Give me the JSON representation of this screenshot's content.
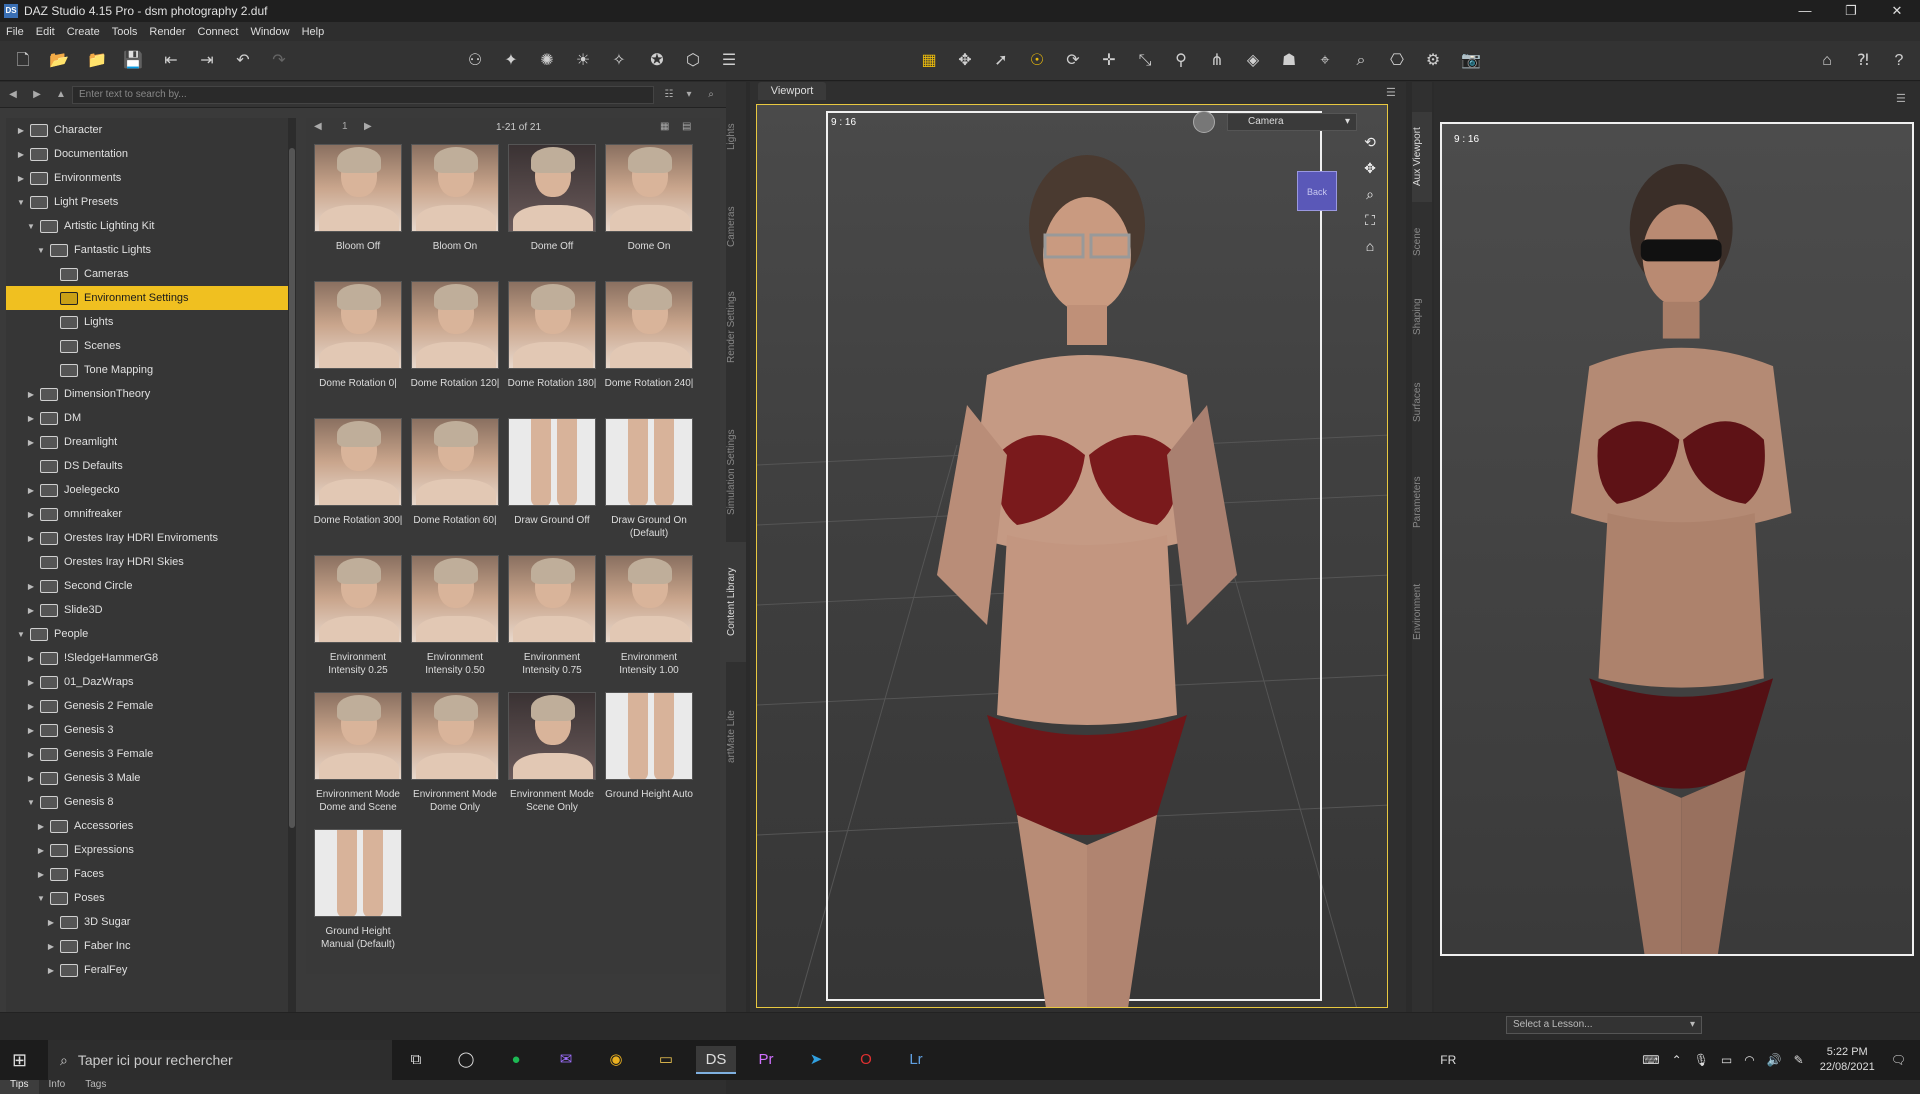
{
  "window": {
    "title": "DAZ Studio 4.15 Pro - dsm photography 2.duf",
    "app_icon": "DS",
    "min": "—",
    "max": "❐",
    "close": "✕"
  },
  "menu": [
    "File",
    "Edit",
    "Create",
    "Tools",
    "Render",
    "Connect",
    "Window",
    "Help"
  ],
  "search": {
    "placeholder": "Enter text to search by..."
  },
  "tree": [
    {
      "label": "Character",
      "indent": 1,
      "arrow": "▶"
    },
    {
      "label": "Documentation",
      "indent": 1,
      "arrow": "▶"
    },
    {
      "label": "Environments",
      "indent": 1,
      "arrow": "▶"
    },
    {
      "label": "Light Presets",
      "indent": 1,
      "arrow": "▼"
    },
    {
      "label": "Artistic Lighting Kit",
      "indent": 2,
      "arrow": "▼"
    },
    {
      "label": "Fantastic Lights",
      "indent": 3,
      "arrow": "▼"
    },
    {
      "label": "Cameras",
      "indent": 4,
      "arrow": ""
    },
    {
      "label": "Environment Settings",
      "indent": 4,
      "arrow": "",
      "selected": true
    },
    {
      "label": "Lights",
      "indent": 4,
      "arrow": ""
    },
    {
      "label": "Scenes",
      "indent": 4,
      "arrow": ""
    },
    {
      "label": "Tone Mapping",
      "indent": 4,
      "arrow": ""
    },
    {
      "label": "DimensionTheory",
      "indent": 2,
      "arrow": "▶"
    },
    {
      "label": "DM",
      "indent": 2,
      "arrow": "▶"
    },
    {
      "label": "Dreamlight",
      "indent": 2,
      "arrow": "▶"
    },
    {
      "label": "DS Defaults",
      "indent": 2,
      "arrow": ""
    },
    {
      "label": "Joelegecko",
      "indent": 2,
      "arrow": "▶"
    },
    {
      "label": "omnifreaker",
      "indent": 2,
      "arrow": "▶"
    },
    {
      "label": "Orestes Iray HDRI Enviroments",
      "indent": 2,
      "arrow": "▶"
    },
    {
      "label": "Orestes Iray HDRI Skies",
      "indent": 2,
      "arrow": ""
    },
    {
      "label": "Second Circle",
      "indent": 2,
      "arrow": "▶"
    },
    {
      "label": "Slide3D",
      "indent": 2,
      "arrow": "▶"
    },
    {
      "label": "People",
      "indent": 1,
      "arrow": "▼"
    },
    {
      "label": "!SledgeHammerG8",
      "indent": 2,
      "arrow": "▶"
    },
    {
      "label": "01_DazWraps",
      "indent": 2,
      "arrow": "▶"
    },
    {
      "label": "Genesis 2 Female",
      "indent": 2,
      "arrow": "▶"
    },
    {
      "label": "Genesis 3",
      "indent": 2,
      "arrow": "▶"
    },
    {
      "label": "Genesis 3 Female",
      "indent": 2,
      "arrow": "▶"
    },
    {
      "label": "Genesis 3 Male",
      "indent": 2,
      "arrow": "▶"
    },
    {
      "label": "Genesis 8",
      "indent": 2,
      "arrow": "▼"
    },
    {
      "label": "Accessories",
      "indent": 3,
      "arrow": "▶"
    },
    {
      "label": "Expressions",
      "indent": 3,
      "arrow": "▶"
    },
    {
      "label": "Faces",
      "indent": 3,
      "arrow": "▶"
    },
    {
      "label": "Poses",
      "indent": 3,
      "arrow": "▼"
    },
    {
      "label": "3D Sugar",
      "indent": 4,
      "arrow": "▶"
    },
    {
      "label": "Faber Inc",
      "indent": 4,
      "arrow": "▶"
    },
    {
      "label": "FeralFey",
      "indent": 4,
      "arrow": "▶"
    }
  ],
  "grid": {
    "page": "1",
    "count": "1-21 of 21",
    "items": [
      {
        "label": "Bloom Off",
        "kind": "head"
      },
      {
        "label": "Bloom On",
        "kind": "head"
      },
      {
        "label": "Dome Off",
        "kind": "dark"
      },
      {
        "label": "Dome On",
        "kind": "head"
      },
      {
        "label": "Dome Rotation 0|",
        "kind": "head"
      },
      {
        "label": "Dome Rotation 120|",
        "kind": "head"
      },
      {
        "label": "Dome Rotation 180|",
        "kind": "head"
      },
      {
        "label": "Dome Rotation 240|",
        "kind": "head"
      },
      {
        "label": "Dome Rotation 300|",
        "kind": "head"
      },
      {
        "label": "Dome Rotation 60|",
        "kind": "head"
      },
      {
        "label": "Draw Ground Off",
        "kind": "legs"
      },
      {
        "label": "Draw Ground On (Default)",
        "kind": "legs"
      },
      {
        "label": "Environment Intensity 0.25",
        "kind": "head"
      },
      {
        "label": "Environment Intensity 0.50",
        "kind": "head"
      },
      {
        "label": "Environment Intensity 0.75",
        "kind": "head"
      },
      {
        "label": "Environment Intensity 1.00",
        "kind": "head"
      },
      {
        "label": "Environment Mode Dome and Scene",
        "kind": "head"
      },
      {
        "label": "Environment Mode Dome Only",
        "kind": "head"
      },
      {
        "label": "Environment Mode Scene Only",
        "kind": "dark"
      },
      {
        "label": "Ground Height Auto",
        "kind": "legs"
      },
      {
        "label": "Ground Height Manual (Default)",
        "kind": "legs"
      }
    ]
  },
  "bottom_tabs": [
    "Tips",
    "Info",
    "Tags"
  ],
  "left_vtabs": [
    "Lights",
    "Cameras",
    "Render Settings",
    "Simulation Settings",
    "Content Library",
    "artMate Lite"
  ],
  "right_vtabs": [
    "Aux Viewport",
    "Scene",
    "Shaping",
    "Surfaces",
    "Parameters",
    "Environment"
  ],
  "viewport": {
    "tab": "Viewport",
    "ratio": "9 : 16",
    "camera": "Camera",
    "cube_label": "Back"
  },
  "aux": {
    "ratio": "9 : 16"
  },
  "lesson": {
    "placeholder": "Select a Lesson..."
  },
  "taskbar": {
    "search_placeholder": "Taper ici pour rechercher",
    "lang": "FR",
    "time": "5:22 PM",
    "date": "22/08/2021"
  },
  "colors": {
    "selection": "#f0c020",
    "viewport_border": "#e8c840",
    "cube": "#5a58b8"
  }
}
